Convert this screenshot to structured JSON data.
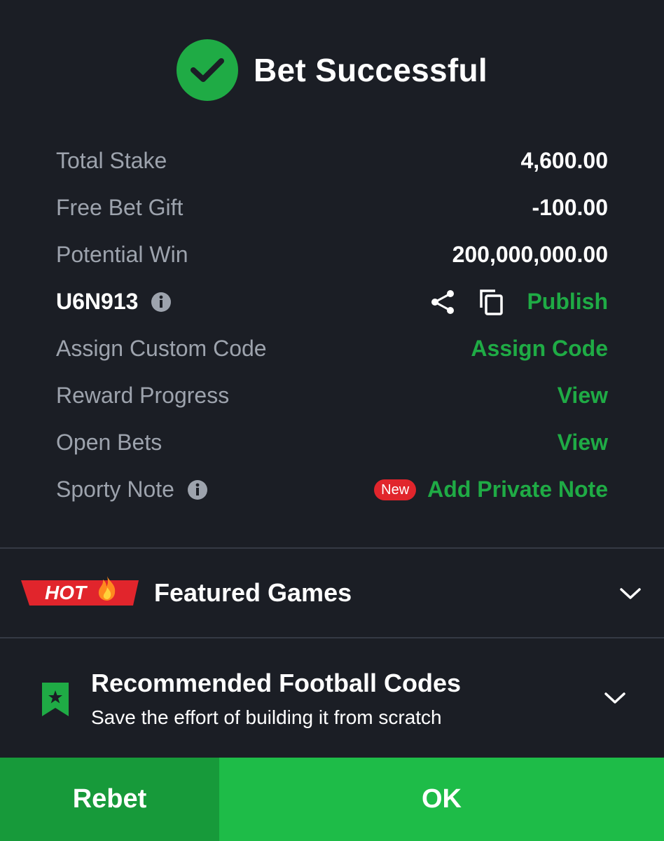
{
  "header": {
    "title": "Bet Successful"
  },
  "summary": {
    "total_stake_label": "Total Stake",
    "total_stake_value": "4,600.00",
    "free_bet_label": "Free Bet Gift",
    "free_bet_value": "-100.00",
    "potential_win_label": "Potential Win",
    "potential_win_value": "200,000,000.00"
  },
  "booking": {
    "code": "U6N913",
    "publish_label": "Publish"
  },
  "custom_code": {
    "label": "Assign Custom Code",
    "action": "Assign Code"
  },
  "reward": {
    "label": "Reward Progress",
    "action": "View"
  },
  "open_bets": {
    "label": "Open Bets",
    "action": "View"
  },
  "note": {
    "label": "Sporty Note",
    "badge": "New",
    "action": "Add Private Note"
  },
  "featured": {
    "badge": "HOT",
    "title": "Featured Games"
  },
  "recommended": {
    "title": "Recommended Football Codes",
    "subtitle": "Save the effort of building it from scratch"
  },
  "buttons": {
    "rebet": "Rebet",
    "ok": "OK"
  },
  "colors": {
    "background": "#1b1e25",
    "accent_green": "#1fab45",
    "badge_red": "#e1252c",
    "ok_green": "#1ebc48",
    "rebet_green": "#179a3a"
  }
}
